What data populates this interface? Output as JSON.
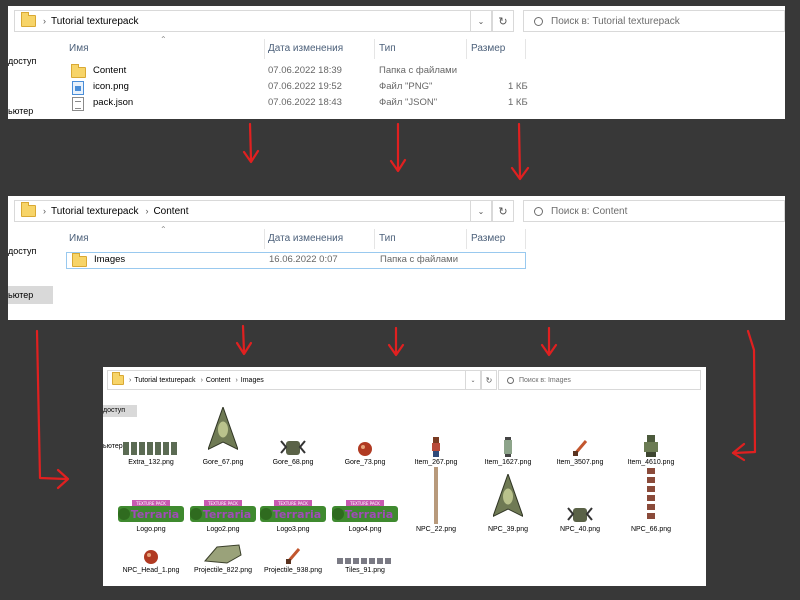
{
  "panel1": {
    "breadcrumb": [
      "Tutorial texturepack"
    ],
    "search_placeholder": "Поиск в: Tutorial texturepack",
    "sidebar": [
      "доступ",
      "ьютер"
    ],
    "columns": [
      "Имя",
      "Дата изменения",
      "Тип",
      "Размер"
    ],
    "rows": [
      {
        "icon": "folder-icon",
        "name": "Content",
        "date": "07.06.2022 18:39",
        "type": "Папка с файлами",
        "size": ""
      },
      {
        "icon": "png-file-icon",
        "name": "icon.png",
        "date": "07.06.2022 19:52",
        "type": "Файл \"PNG\"",
        "size": "1 КБ"
      },
      {
        "icon": "json-file-icon",
        "name": "pack.json",
        "date": "07.06.2022 18:43",
        "type": "Файл \"JSON\"",
        "size": "1 КБ"
      }
    ]
  },
  "panel2": {
    "breadcrumb": [
      "Tutorial texturepack",
      "Content"
    ],
    "search_placeholder": "Поиск в: Content",
    "sidebar": [
      "доступ",
      "ьютер"
    ],
    "columns": [
      "Имя",
      "Дата изменения",
      "Тип",
      "Размер"
    ],
    "rows": [
      {
        "icon": "folder-icon",
        "name": "Images",
        "date": "16.06.2022 0:07",
        "type": "Папка с файлами",
        "size": ""
      }
    ]
  },
  "panel3": {
    "breadcrumb": [
      "Tutorial texturepack",
      "Content",
      "Images"
    ],
    "search_placeholder": "Поиск в: Images",
    "sidebar": [
      "доступ",
      "ьютер"
    ],
    "files": [
      {
        "name": "Extra_132.png",
        "thumb": "sprite-row"
      },
      {
        "name": "Gore_67.png",
        "thumb": "ship"
      },
      {
        "name": "Gore_68.png",
        "thumb": "claw"
      },
      {
        "name": "Gore_73.png",
        "thumb": "red-blob"
      },
      {
        "name": "Item_267.png",
        "thumb": "character"
      },
      {
        "name": "Item_1627.png",
        "thumb": "lantern"
      },
      {
        "name": "Item_3507.png",
        "thumb": "sword"
      },
      {
        "name": "Item_4610.png",
        "thumb": "armor"
      },
      {
        "name": "Logo.png",
        "thumb": "logo"
      },
      {
        "name": "Logo2.png",
        "thumb": "logo"
      },
      {
        "name": "Logo3.png",
        "thumb": "logo"
      },
      {
        "name": "Logo4.png",
        "thumb": "logo"
      },
      {
        "name": "NPC_22.png",
        "thumb": "tall-strip"
      },
      {
        "name": "NPC_39.png",
        "thumb": "ship"
      },
      {
        "name": "NPC_40.png",
        "thumb": "claw"
      },
      {
        "name": "NPC_66.png",
        "thumb": "tall-strip-red"
      },
      {
        "name": "NPC_Head_1.png",
        "thumb": "red-blob"
      },
      {
        "name": "Projectile_822.png",
        "thumb": "skull"
      },
      {
        "name": "Projectile_938.png",
        "thumb": "sword"
      },
      {
        "name": "Tiles_91.png",
        "thumb": "sprite-row-gray"
      }
    ],
    "logo_caption": "TEXTURE PACK",
    "logo_word": "Terraria"
  },
  "colors": {
    "background": "#383838",
    "arrow": "#e02020",
    "header_text": "#4c607a",
    "folder": "#f7d468",
    "selection": "#cde8ff"
  }
}
